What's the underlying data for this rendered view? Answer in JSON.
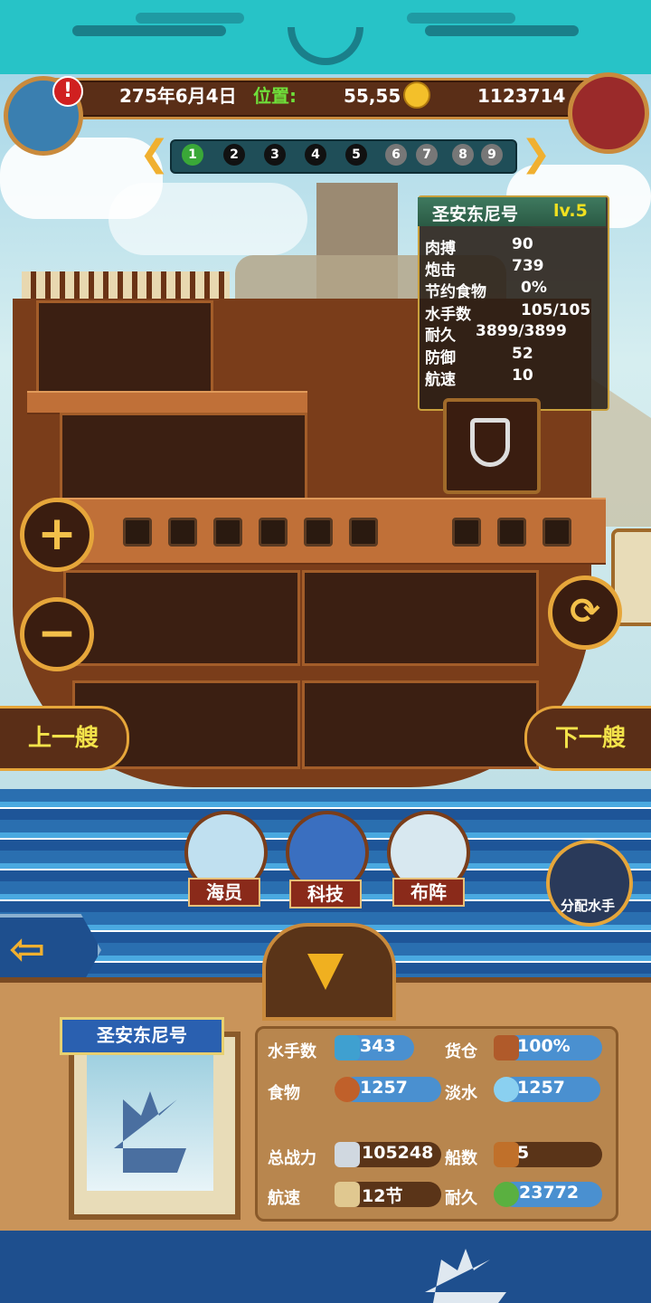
{
  "header": {
    "date": "275年6月4日",
    "position_label": "位置:",
    "position_value": "55,55",
    "gold": "1123714",
    "alert_mark": "!"
  },
  "pager": {
    "pages": [
      "1",
      "2",
      "3",
      "4",
      "5",
      "6",
      "7",
      "8",
      "9"
    ],
    "active_page": "1",
    "prev_symbol": "❮",
    "next_symbol": "❯"
  },
  "ship_info": {
    "name": "圣安东尼号",
    "level": "lv.5",
    "stats": [
      {
        "label": "肉搏",
        "value": "90"
      },
      {
        "label": "炮击",
        "value": "739"
      },
      {
        "label": "节约食物",
        "value": "0%"
      },
      {
        "label": "水手数",
        "value": "105/105"
      },
      {
        "label": "耐久",
        "value": "3899/3899"
      },
      {
        "label": "防御",
        "value": "52"
      },
      {
        "label": "航速",
        "value": "10"
      }
    ]
  },
  "controls": {
    "plus": "+",
    "minus": "−",
    "prev_ship": "上一艘",
    "next_ship": "下一艘"
  },
  "menu": {
    "crew": "海员",
    "tech": "科技",
    "formation": "布阵",
    "assign_sailors": "分配水手"
  },
  "bottom": {
    "back_symbol": "⇦",
    "ship_name": "圣安东尼号",
    "stats": {
      "sailors_label": "水手数",
      "sailors_value": "343",
      "cargo_label": "货仓",
      "cargo_value": "100%",
      "food_label": "食物",
      "food_value": "1257",
      "water_label": "淡水",
      "water_value": "1257",
      "power_label": "总战力",
      "power_value": "105248",
      "ships_label": "船数",
      "ships_value": "5",
      "speed_label": "航速",
      "speed_value": "12节",
      "durability_label": "耐久",
      "durability_value": "23772"
    }
  },
  "colors": {
    "teal_banner": "#27c3c7",
    "wood_dark": "#5a2e17",
    "gold_trim": "#e6a63a",
    "button_text": "#f3e34a",
    "level_text": "#f0e020",
    "active_page": "#3aa838"
  }
}
